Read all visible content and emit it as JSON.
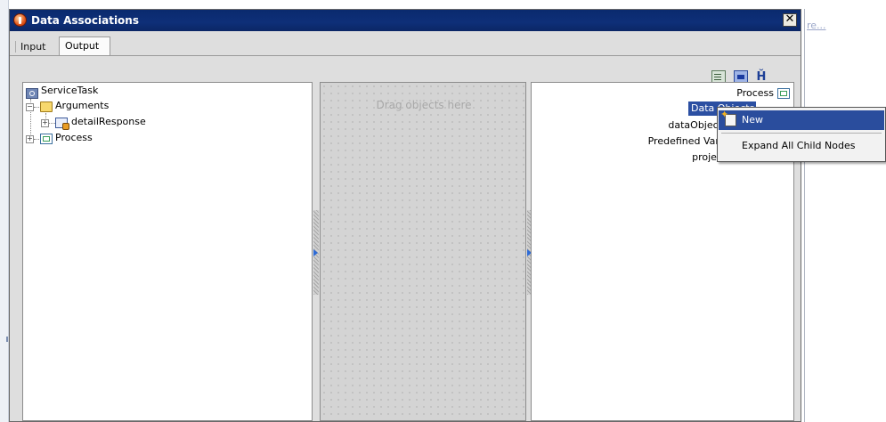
{
  "background_link": "re...",
  "dialog": {
    "title": "Data Associations",
    "close_label": "✕"
  },
  "tabs": [
    {
      "label": "Input",
      "active": false
    },
    {
      "label": "Output",
      "active": true
    }
  ],
  "toolbar": {
    "icons": [
      "add-function-icon",
      "expression-builder-icon",
      "auto-map-icon"
    ],
    "auto_map_glyph": "Ȟ"
  },
  "source_tree": {
    "root": "ServiceTask",
    "arguments": "Arguments",
    "detail_response": "detailResponse",
    "process": "Process",
    "expanders": {
      "arguments": "−",
      "detail_response": "+",
      "process": "+"
    }
  },
  "middle_panel": {
    "hint": "Drag objects here"
  },
  "target_tree": {
    "process": "Process",
    "data_objects": "Data Objects",
    "data_object": "dataObject",
    "predefined_variables": "Predefined Vari",
    "project": "projec"
  },
  "context_menu": {
    "items": [
      {
        "label": "New",
        "selected": true
      },
      {
        "label": "Expand All Child Nodes",
        "selected": false
      }
    ]
  },
  "colors": {
    "title_bar": "#0e2f78",
    "selection": "#2b4fa2",
    "dialog_bg": "#dedede",
    "drop_zone": "#d4d4d4"
  }
}
